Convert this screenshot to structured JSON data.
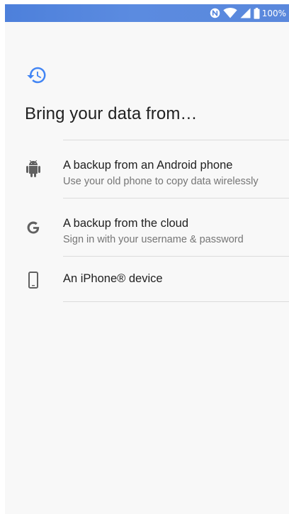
{
  "status_bar": {
    "battery_label": "100%",
    "icons": [
      "nfc-icon",
      "wifi-icon",
      "signal-icon",
      "battery-icon"
    ]
  },
  "header": {
    "icon": "history-icon",
    "title": "Bring your data from…"
  },
  "options": [
    {
      "icon": "android-icon",
      "title": "A backup from an Android phone",
      "subtitle": "Use your old phone to copy data wirelessly"
    },
    {
      "icon": "google-icon",
      "title": "A backup from the cloud",
      "subtitle": "Sign in with your username & password"
    },
    {
      "icon": "phone-icon",
      "title": "An iPhone® device",
      "subtitle": ""
    }
  ],
  "colors": {
    "accent": "#4285f4",
    "status_bar": "#5686dd",
    "icon_gray": "#616161",
    "divider": "#dcdcdc"
  }
}
